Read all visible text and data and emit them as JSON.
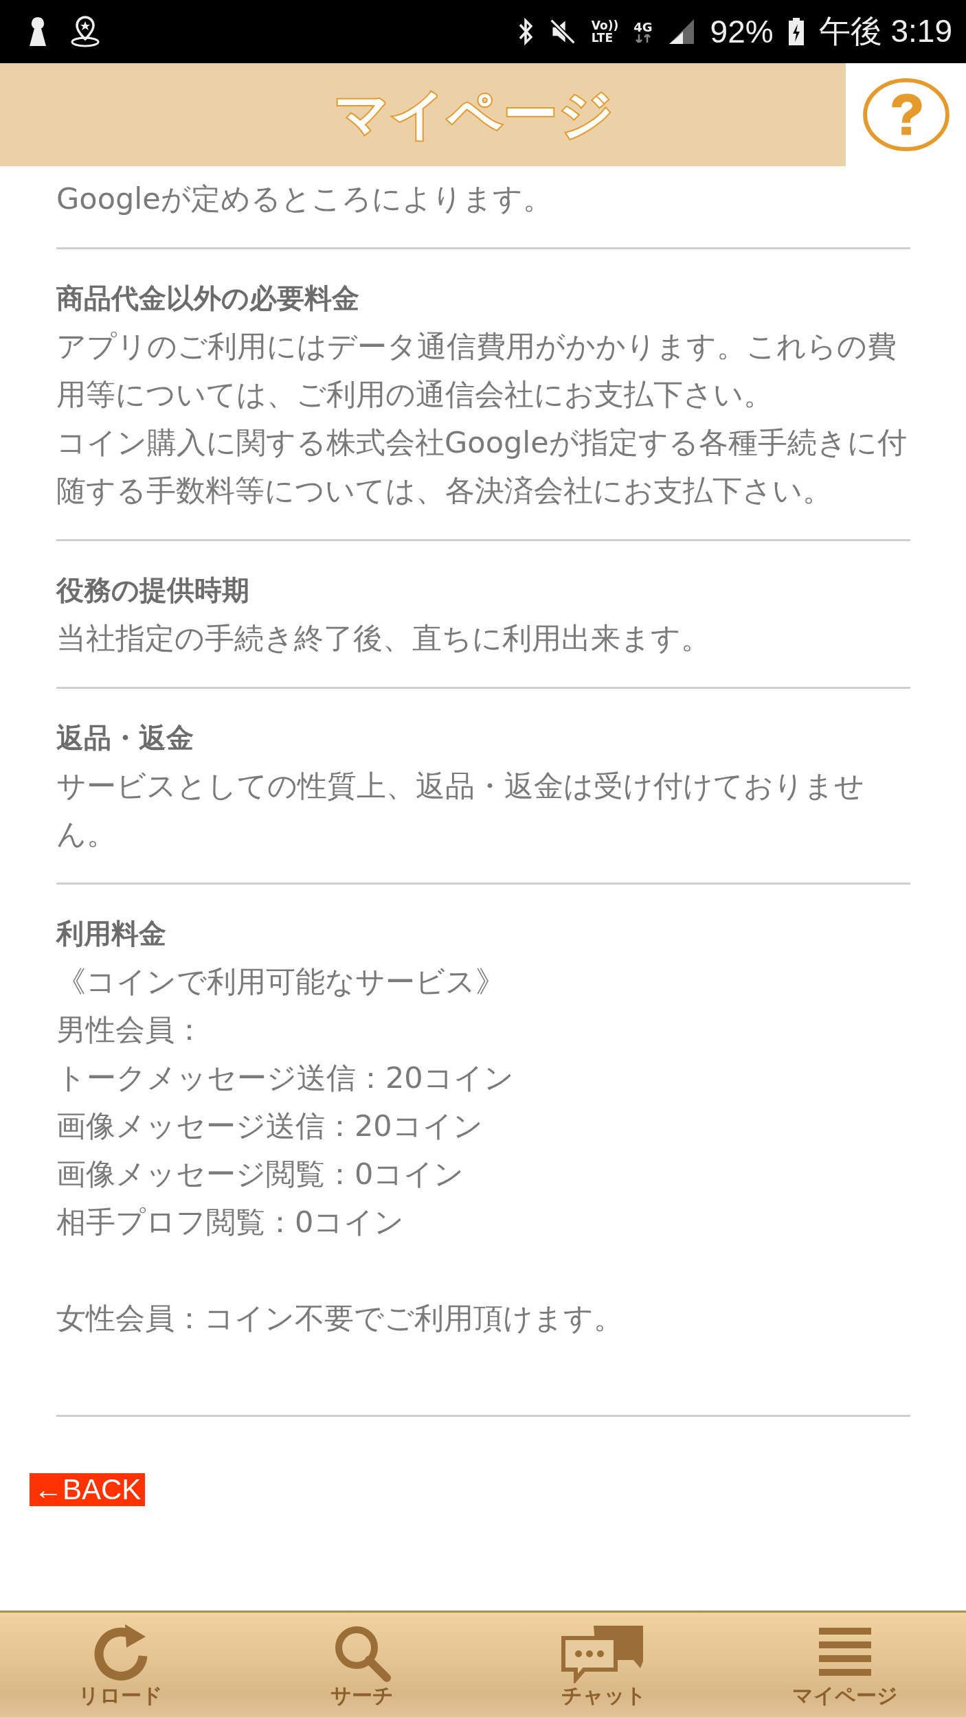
{
  "status_bar": {
    "volte_top": "Vo))",
    "volte_bottom": "LTE",
    "network": "4G",
    "battery": "92%",
    "time": "午後 3:19"
  },
  "header": {
    "title": "マイページ"
  },
  "sections": [
    {
      "paragraphs": [
        "Googleが定めるところによります。"
      ]
    },
    {
      "heading": "商品代金以外の必要料金",
      "paragraphs": [
        "アプリのご利用にはデータ通信費用がかかります。これらの費用等については、ご利用の通信会社にお支払下さい。",
        "コイン購入に関する株式会社Googleが指定する各種手続きに付随する手数料等については、各決済会社にお支払下さい。"
      ]
    },
    {
      "heading": "役務の提供時期",
      "paragraphs": [
        "当社指定の手続き終了後、直ちに利用出来ます。"
      ]
    },
    {
      "heading": "返品・返金",
      "paragraphs": [
        "サービスとしての性質上、返品・返金は受け付けておりません。"
      ]
    },
    {
      "heading": "利用料金",
      "paragraphs": [
        "《コインで利用可能なサービス》",
        "男性会員：",
        "トークメッセージ送信：20コイン",
        "画像メッセージ送信：20コイン",
        "画像メッセージ閲覧：0コイン",
        "相手プロフ閲覧：0コイン"
      ],
      "note": "女性会員：コイン不要でご利用頂けます。"
    }
  ],
  "back_button": "←BACK",
  "nav": [
    {
      "kind": "reload",
      "label": "リロード"
    },
    {
      "kind": "search",
      "label": "サーチ"
    },
    {
      "kind": "chat",
      "label": "チャット"
    },
    {
      "kind": "menu",
      "label": "マイページ"
    }
  ]
}
